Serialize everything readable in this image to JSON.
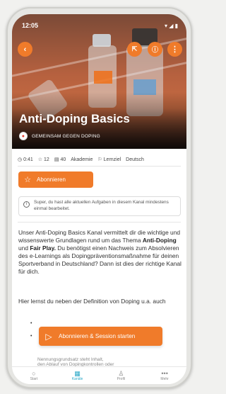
{
  "status_bar": {
    "time": "12:05",
    "indicators": "▾ ◢ ▮"
  },
  "header": {
    "back_icon": "chevron-left-icon",
    "actions": [
      "share-icon",
      "info-icon",
      "more-vertical-icon"
    ]
  },
  "course": {
    "title": "Anti-Doping Basics",
    "org": "GEMEINSAM GEGEN DOPING"
  },
  "meta": [
    {
      "icon": "clock-icon",
      "glyph": "◷",
      "text": "0:41"
    },
    {
      "icon": "star-icon",
      "glyph": "☆",
      "text": "12"
    },
    {
      "icon": "document-icon",
      "glyph": "▤",
      "text": "40"
    },
    {
      "icon": "tag",
      "glyph": "",
      "text": "Akademie"
    },
    {
      "icon": "flag-icon",
      "glyph": "⚐",
      "text": "Lernziel"
    },
    {
      "icon": "language",
      "glyph": "",
      "text": "Deutsch"
    }
  ],
  "subscribe": {
    "label": "Abonnieren",
    "icon": "star-outline-icon"
  },
  "info_box": {
    "text": "Super, du hast alle aktuellen Aufgaben in diesem Kanal mindestens einmal bearbeitet."
  },
  "description": {
    "p1_a": "Unser Anti-Doping Basics Kanal vermittelt dir die wichtige und wissenswerte Grundlagen rund um das Thema ",
    "p1_b": "Anti-Doping",
    "p1_c": " und ",
    "p1_d": "Fair Play.",
    "p1_e": " Du benötigst einen Nachweis zum Absolvieren des e-Learnings als Dopingpräventionsmaßnahme für deinen Sportverband in Deutschland? Dann ist dies der richtige Kanal für dich.",
    "p2": "Hier lernst du neben der Definition von Doping u.a. auch",
    "faded_1": "Nennungsgrundsatz steht Inhalt,",
    "faded_2": "den Ablauf von Dopingkontrollen oder"
  },
  "start_button": {
    "label": "Abonnieren & Session starten",
    "icon": "play-icon"
  },
  "tabs": [
    {
      "label": "Start",
      "icon": "circle-icon",
      "glyph": "○"
    },
    {
      "label": "Kanäle",
      "icon": "grid-icon",
      "glyph": "▦",
      "active": true
    },
    {
      "label": "Profil",
      "icon": "user-icon",
      "glyph": "♙"
    },
    {
      "label": "Mehr",
      "icon": "more-icon",
      "glyph": "•••"
    }
  ],
  "colors": {
    "accent": "#f07b2a",
    "tab_active": "#2aa8c7"
  }
}
